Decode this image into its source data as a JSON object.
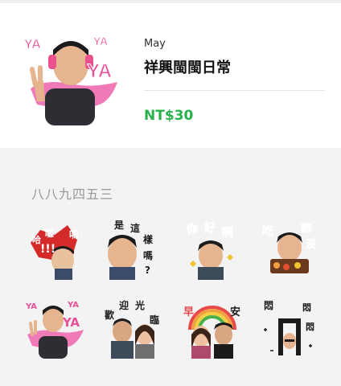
{
  "product": {
    "creator": "May",
    "title": "祥興閩閩日常",
    "price": "NT$30"
  },
  "main_sticker": {
    "icon": "waving-man-ya-sticker-icon",
    "badges": [
      "YA",
      "YA",
      "YA"
    ]
  },
  "pack_label": "八八九四五三",
  "stickers": [
    {
      "icon": "hi-exclaim-sticker-icon",
      "chars": [
        "哈",
        "囉",
        "嗎",
        "!!!"
      ]
    },
    {
      "icon": "is-it-so-sticker-icon",
      "chars": [
        "是",
        "這",
        "樣",
        "嗎",
        "?"
      ]
    },
    {
      "icon": "hello-sticker-icon",
      "chars": [
        "你",
        "好",
        "啊"
      ]
    },
    {
      "icon": "full-sticker-icon",
      "chars": [
        "吃",
        "飽",
        "沒"
      ]
    },
    {
      "icon": "ya-sticker-icon",
      "chars": [
        "YA",
        "YA",
        "YA"
      ]
    },
    {
      "icon": "welcome-sticker-icon",
      "chars": [
        "歡",
        "迎",
        "光",
        "臨"
      ]
    },
    {
      "icon": "good-morning-sticker-icon",
      "chars": [
        "早",
        "安"
      ]
    },
    {
      "icon": "bored-sticker-icon",
      "chars": [
        "悶",
        "悶",
        "悶"
      ]
    }
  ],
  "colors": {
    "price": "#27b14a",
    "ya_pink": "#e8519a",
    "hello_pink": "#e04a96",
    "eat_purple": "#8a4fc0",
    "alert_red": "#d42a2a"
  }
}
